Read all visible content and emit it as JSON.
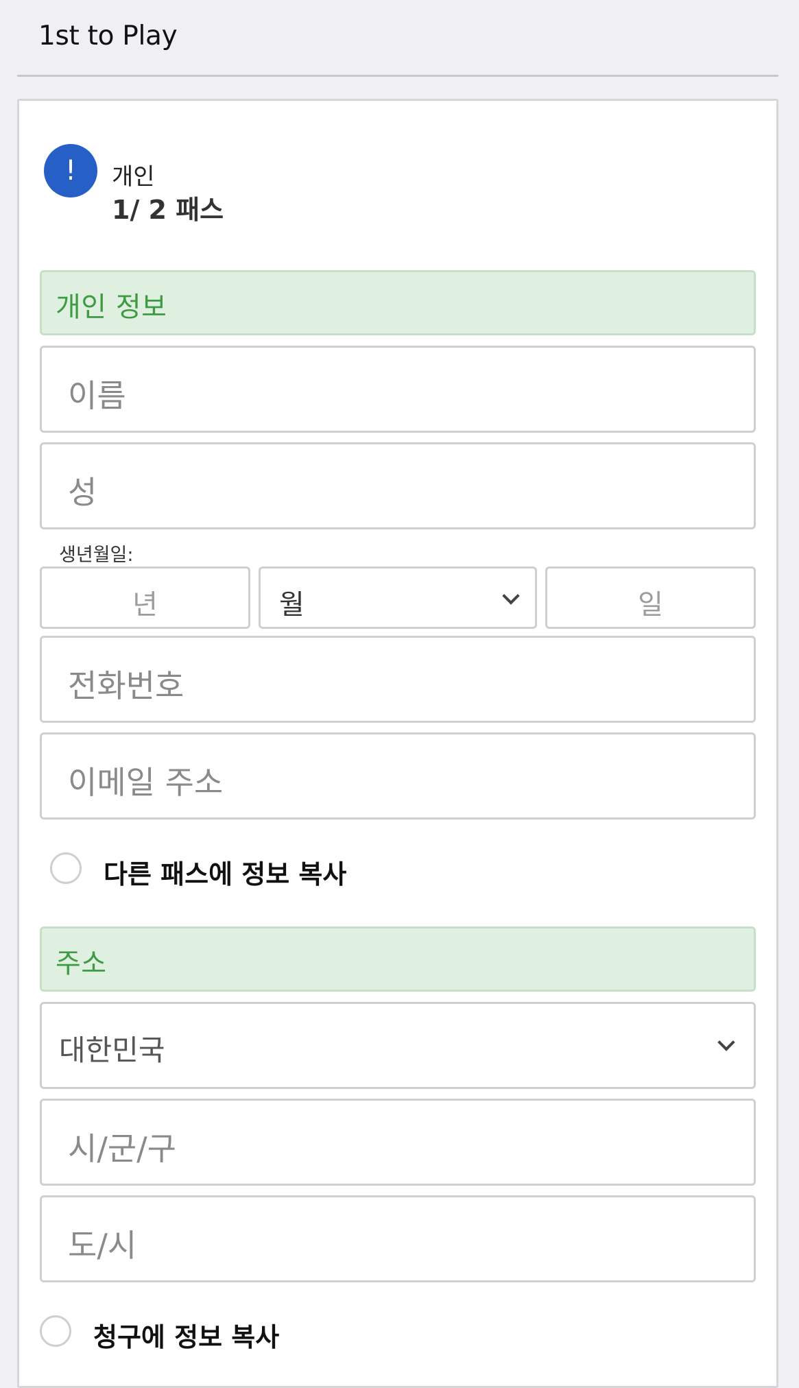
{
  "header": {
    "title": "1st to Play"
  },
  "pass": {
    "badge_icon": "!",
    "type": "개인",
    "count": "1/ 2 패스"
  },
  "personal_section": {
    "title": "개인 정보",
    "first_name_placeholder": "이름",
    "last_name_placeholder": "성",
    "dob_label": "생년월일:",
    "year_placeholder": "년",
    "month_value": "월",
    "day_placeholder": "일",
    "phone_placeholder": "전화번호",
    "email_placeholder": "이메일 주소",
    "copy_to_other_pass": "다른 패스에 정보 복사"
  },
  "address_section": {
    "title": "주소",
    "country_value": "대한민국",
    "city_placeholder": "시/군/구",
    "province_placeholder": "도/시",
    "copy_to_billing": "청구에 정보 복사"
  },
  "colors": {
    "accent_blue": "#2660c7",
    "section_green_text": "#3f9b43",
    "section_green_bg": "#dff0e1"
  }
}
